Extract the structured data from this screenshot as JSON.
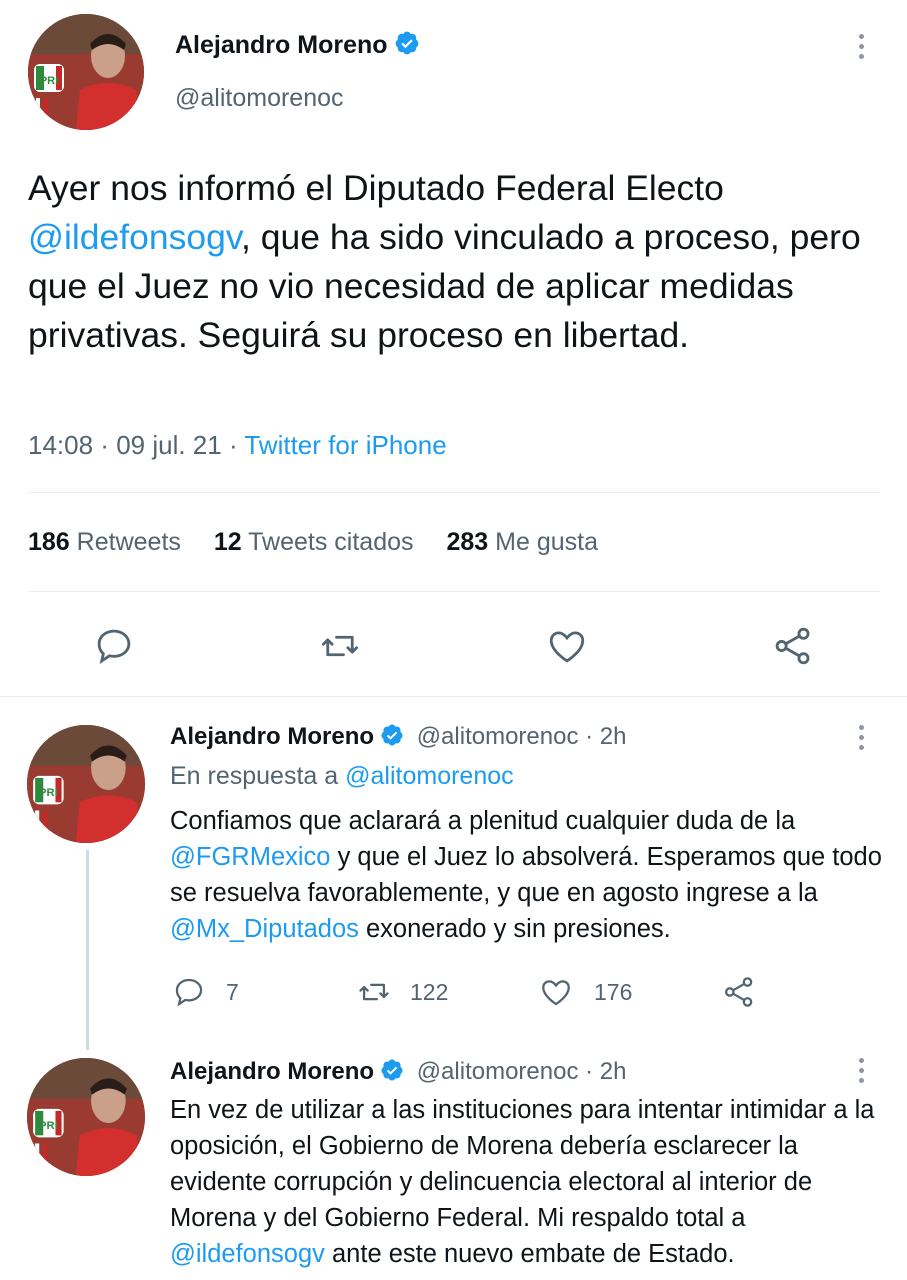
{
  "main_tweet": {
    "author_name": "Alejandro Moreno",
    "handle": "@alitomorenoc",
    "text_parts": [
      {
        "t": "Ayer nos informó el Diputado Federal Electo ",
        "link": false
      },
      {
        "t": "@ildefonsogv",
        "link": true
      },
      {
        "t": ", que ha sido vinculado a proceso, pero que el Juez no vio necesidad de aplicar medidas privativas. Seguirá su proceso en libertad.",
        "link": false
      }
    ],
    "time": "14:08",
    "date": "09 jul. 21",
    "source": "Twitter for iPhone",
    "stats": {
      "retweets_count": "186",
      "retweets_label": "Retweets",
      "quotes_count": "12",
      "quotes_label": "Tweets citados",
      "likes_count": "283",
      "likes_label": "Me gusta"
    }
  },
  "replies": [
    {
      "author_name": "Alejandro Moreno",
      "handle": "@alitomorenoc",
      "time": "· 2h",
      "replying_prefix": "En respuesta a",
      "replying_to": "@alitomorenoc",
      "text_parts": [
        {
          "t": "Confiamos que aclarará a plenitud cualquier duda de la ",
          "link": false
        },
        {
          "t": "@FGRMexico",
          "link": true
        },
        {
          "t": " y que el Juez lo absolverá. Esperamos que todo se resuelva favorablemente, y que en agosto ingrese a la ",
          "link": false
        },
        {
          "t": "@Mx_Diputados",
          "link": true
        },
        {
          "t": " exonerado y sin presiones.",
          "link": false
        }
      ],
      "replies_count": "7",
      "retweets_count": "122",
      "likes_count": "176"
    },
    {
      "author_name": "Alejandro Moreno",
      "handle": "@alitomorenoc",
      "time": "· 2h",
      "text_parts": [
        {
          "t": "En vez de utilizar a las instituciones para intentar intimidar a la oposición, el Gobierno de Morena debería esclarecer la evidente corrupción y delincuencia electoral al interior de Morena y del Gobierno Federal. Mi respaldo total a ",
          "link": false
        },
        {
          "t": "@ildefonsogv",
          "link": true
        },
        {
          "t": " ante este nuevo embate de Estado.",
          "link": false
        }
      ]
    }
  ],
  "avatar_logo_text": "PRI",
  "icons": [
    "verified-badge-icon",
    "more-options-icon",
    "reply-icon",
    "retweet-icon",
    "like-icon",
    "share-icon"
  ],
  "colors": {
    "link": "#1d9bf0",
    "muted": "#536471",
    "text": "#0f1419",
    "verified": "#1d9bf0"
  }
}
